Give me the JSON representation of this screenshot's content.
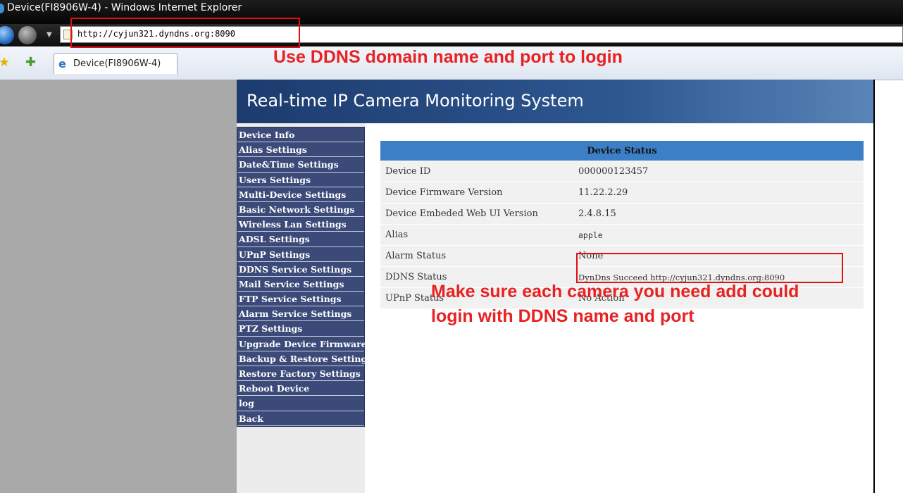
{
  "window": {
    "title": "Device(FI8906W-4) - Windows Internet Explorer"
  },
  "address_bar": {
    "url": "http://cyjun321.dyndns.org:8090"
  },
  "tab": {
    "label": "Device(FI8906W-4)"
  },
  "page": {
    "banner_title": "Real-time IP Camera Monitoring System"
  },
  "menu": {
    "items": [
      "Device Info",
      "Alias Settings",
      "Date&Time Settings",
      "Users Settings",
      "Multi-Device Settings",
      "Basic Network Settings",
      "Wireless Lan Settings",
      "ADSL Settings",
      "UPnP Settings",
      "DDNS Service Settings",
      "Mail Service Settings",
      "FTP Service Settings",
      "Alarm Service Settings",
      "PTZ Settings",
      "Upgrade Device Firmware",
      "Backup & Restore Settings",
      "Restore Factory Settings",
      "Reboot Device",
      "log",
      "Back"
    ]
  },
  "status": {
    "header": "Device Status",
    "rows": [
      {
        "label": "Device ID",
        "value": "000000123457"
      },
      {
        "label": "Device Firmware Version",
        "value": "11.22.2.29"
      },
      {
        "label": "Device Embeded Web UI Version",
        "value": "2.4.8.15"
      },
      {
        "label": "Alias",
        "value": "apple"
      },
      {
        "label": "Alarm Status",
        "value": "None"
      },
      {
        "label": "DDNS Status",
        "value": "DynDns Succeed http://cyjun321.dyndns.org:8090"
      },
      {
        "label": "UPnP Status",
        "value": "No Action"
      }
    ]
  },
  "annotations": {
    "note_login": "Use DDNS domain name and port to login",
    "note_camera_line1": "Make sure each camera you need add could",
    "note_camera_line2": "login with DDNS name and port"
  },
  "colors": {
    "banner": "#2e5790",
    "menu_bg": "#3b4a78",
    "table_header": "#3d7fc6",
    "annotation_red": "#e82222"
  }
}
